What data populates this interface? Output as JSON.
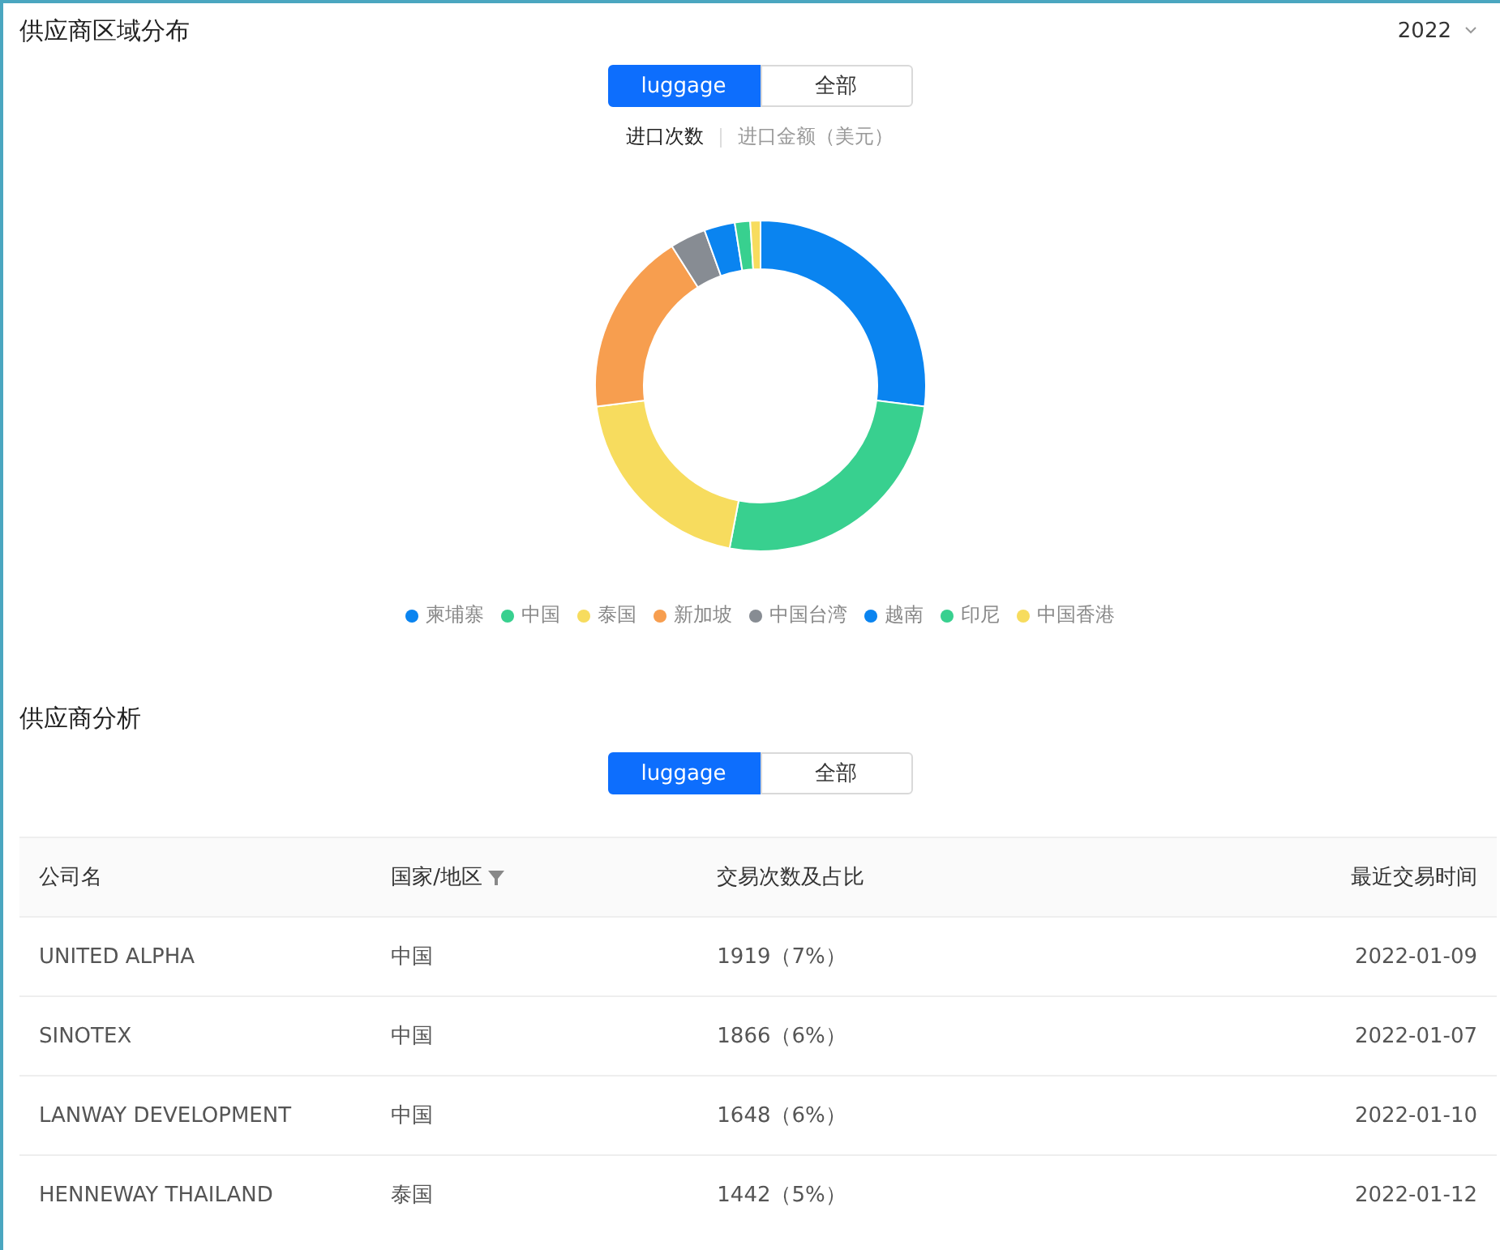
{
  "region_section": {
    "title": "供应商区域分布",
    "year": "2022",
    "segments": [
      {
        "label": "luggage",
        "selected": true
      },
      {
        "label": "全部",
        "selected": false
      }
    ],
    "metric_tabs": [
      {
        "label": "进口次数",
        "selected": true
      },
      {
        "label": "进口金额（美元）",
        "selected": false
      }
    ],
    "legend": [
      {
        "label": "柬埔寨",
        "color": "#0a84f0"
      },
      {
        "label": "中国",
        "color": "#38d08f"
      },
      {
        "label": "泰国",
        "color": "#f7dc5e"
      },
      {
        "label": "新加坡",
        "color": "#f79e4f"
      },
      {
        "label": "中国台湾",
        "color": "#878c93"
      },
      {
        "label": "越南",
        "color": "#0a84f0"
      },
      {
        "label": "印尼",
        "color": "#38d08f"
      },
      {
        "label": "中国香港",
        "color": "#f7dc5e"
      }
    ]
  },
  "supplier_section": {
    "title": "供应商分析",
    "segments": [
      {
        "label": "luggage",
        "selected": true
      },
      {
        "label": "全部",
        "selected": false
      }
    ],
    "table": {
      "columns": [
        "公司名",
        "国家/地区",
        "交易次数及占比",
        "最近交易时间"
      ],
      "rows": [
        [
          "UNITED ALPHA",
          "中国",
          "1919（7%）",
          "2022-01-09"
        ],
        [
          "SINOTEX",
          "中国",
          "1866（6%）",
          "2022-01-07"
        ],
        [
          "LANWAY DEVELOPMENT",
          "中国",
          "1648（6%）",
          "2022-01-10"
        ],
        [
          "HENNEWAY THAILAND",
          "泰国",
          "1442（5%）",
          "2022-01-12"
        ]
      ]
    }
  }
}
